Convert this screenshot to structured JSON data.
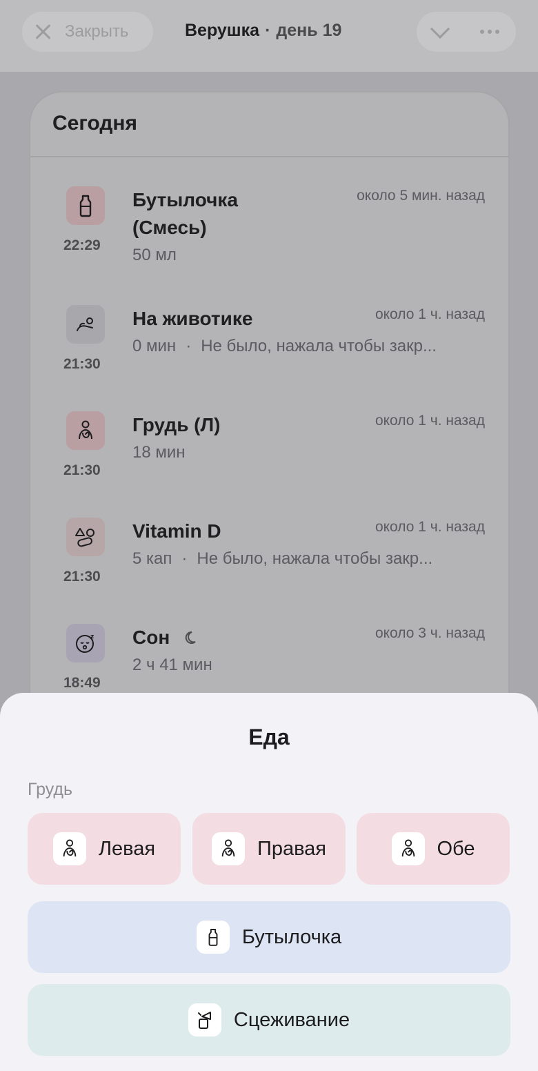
{
  "header": {
    "close_label": "Закрыть",
    "child_name": "Верушка",
    "separator": "·",
    "day_label": "день 19"
  },
  "today": {
    "title": "Сегодня",
    "entries": [
      {
        "icon": "bottle-icon",
        "icon_bg": "#b99ea2",
        "time": "22:29",
        "name": "Бутылочка (Смесь)",
        "ago": "около 5 мин. назад",
        "detail": "50 мл",
        "note": ""
      },
      {
        "icon": "tummy-time-icon",
        "icon_bg": "#a8a8ac",
        "time": "21:30",
        "name": "На животике",
        "ago": "около 1 ч. назад",
        "detail": "0 мин",
        "note": "Не было, нажала чтобы закр..."
      },
      {
        "icon": "breastfeeding-icon",
        "icon_bg": "#b99ea2",
        "time": "21:30",
        "name": "Грудь (Л)",
        "ago": "около 1 ч. назад",
        "detail": "18 мин",
        "note": ""
      },
      {
        "icon": "pills-icon",
        "icon_bg": "#b7a6a8",
        "time": "21:30",
        "name": "Vitamin D",
        "ago": "около 1 ч. назад",
        "detail": "5 кап",
        "note": "Не было, нажала чтобы закр..."
      },
      {
        "icon": "sleep-face-icon",
        "icon_bg": "#a8a4b3",
        "time": "18:49",
        "name": "Сон",
        "ago": "около 3 ч. назад",
        "detail": "2 ч 41 мин",
        "note": ""
      }
    ]
  },
  "sheet": {
    "title": "Еда",
    "section_label": "Грудь",
    "breast_options": [
      "Левая",
      "Правая",
      "Обе"
    ],
    "bottle_label": "Бутылочка",
    "pump_label": "Сцеживание"
  },
  "colors": {
    "breast": "#f3dde2",
    "bottle": "#dde5f4",
    "pump": "#deebec"
  }
}
